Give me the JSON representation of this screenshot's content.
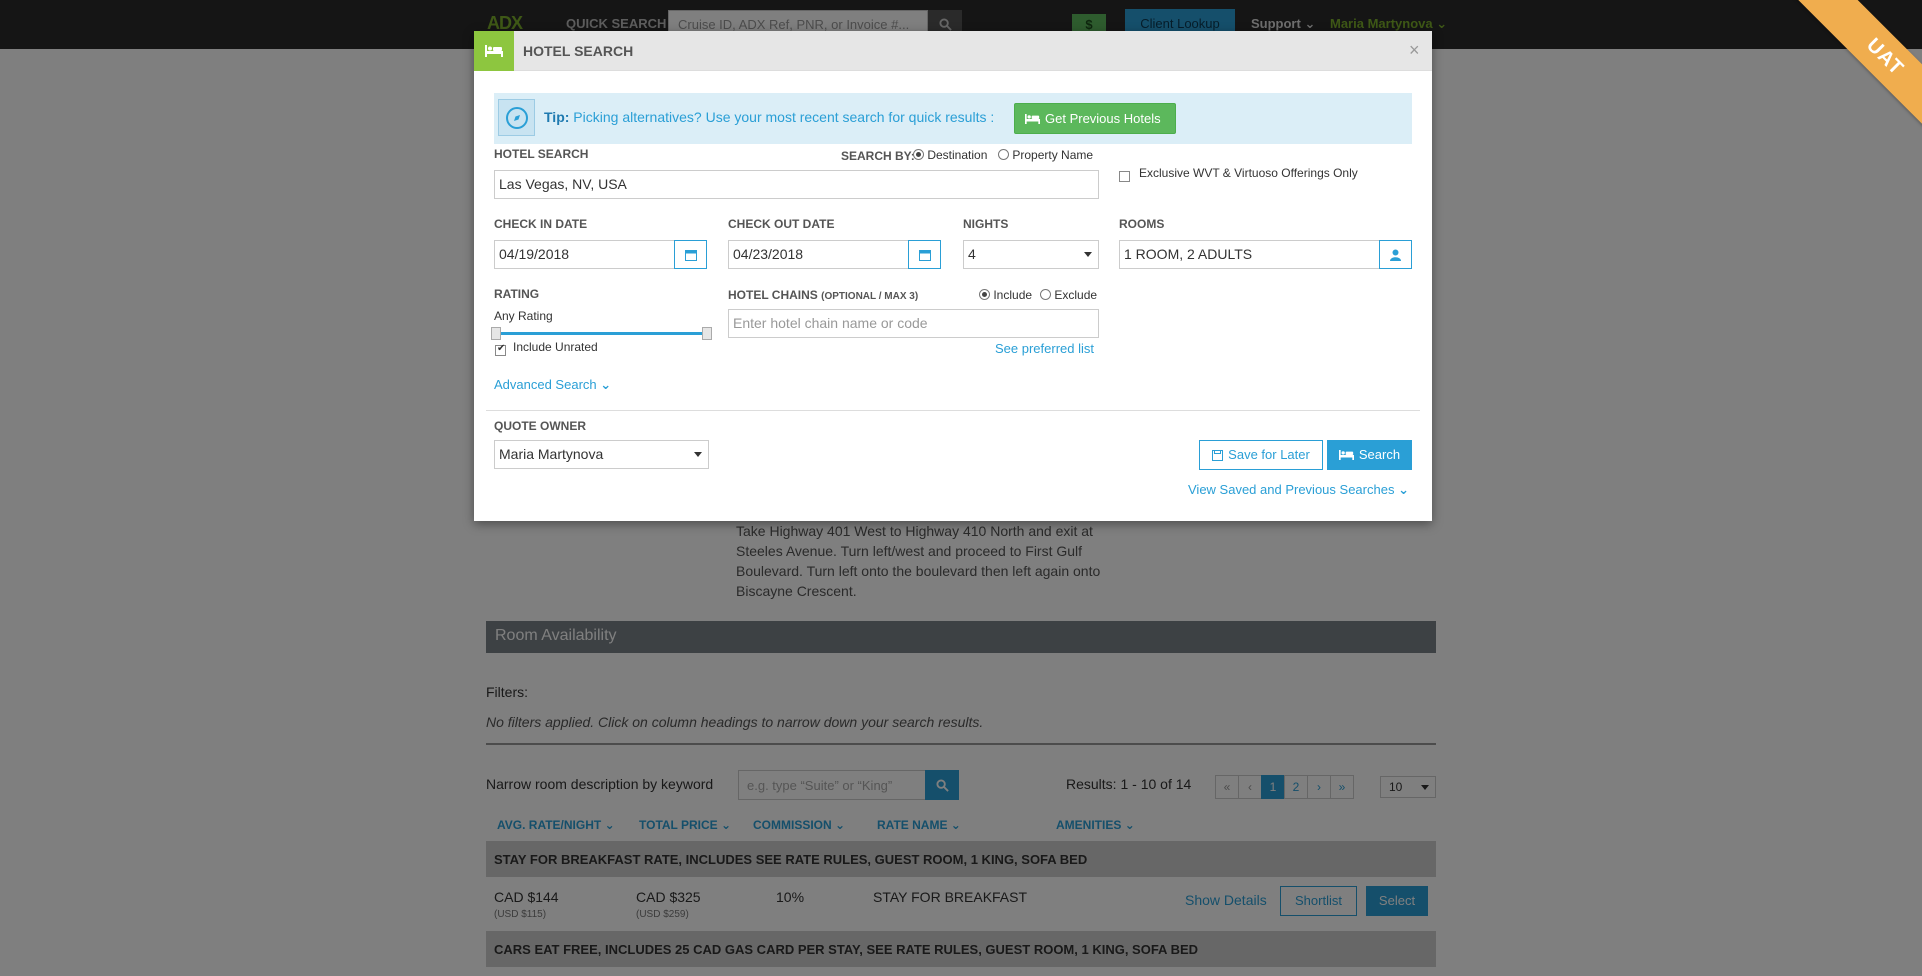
{
  "topnav": {
    "logo": "ADX",
    "quick_search_label": "QUICK SEARCH",
    "quick_search_placeholder": "Cruise ID, ADX Ref, PNR, or Invoice #...",
    "dollar_label": "$",
    "client_lookup_label": "Client Lookup",
    "support_label": "Support",
    "user_label": "Maria Martynova"
  },
  "env_badge": "UAT",
  "background": {
    "directions": "Take Highway 401 West to Highway 410 North and exit at Steeles Avenue. Turn left/west and proceed to First Gulf Boulevard. Turn left onto the boulevard then left again onto Biscayne Crescent.",
    "room_availability_title": "Room Availability",
    "filters_label": "Filters:",
    "no_filters_text": "No filters applied. Click on column headings to narrow down your search results.",
    "narrow_label": "Narrow room description by keyword",
    "keyword_placeholder": "e.g. type “Suite” or “King”",
    "results_text": "Results: 1 - 10 of 14",
    "pager": [
      "«",
      "‹",
      "1",
      "2",
      "›",
      "»"
    ],
    "per_page": "10",
    "columns": [
      "AVG. RATE/NIGHT",
      "TOTAL PRICE",
      "COMMISSION",
      "RATE NAME",
      "AMENITIES"
    ],
    "rates": [
      {
        "title": "STAY FOR BREAKFAST RATE, INCLUDES SEE RATE RULES, GUEST ROOM, 1 KING, SOFA BED",
        "avg_rate": "CAD $144",
        "avg_rate_usd": "(USD $115)",
        "total": "CAD $325",
        "total_usd": "(USD $259)",
        "commission": "10%",
        "rate_name": "STAY FOR BREAKFAST",
        "show_details": "Show Details",
        "shortlist": "Shortlist",
        "select": "Select"
      },
      {
        "title": "CARS EAT FREE, INCLUDES 25 CAD GAS CARD PER STAY, SEE RATE RULES, GUEST ROOM, 1 KING, SOFA BED"
      }
    ]
  },
  "modal": {
    "title": "HOTEL SEARCH",
    "tip_label": "Tip:",
    "tip_text": "Picking alternatives? Use your most recent search for quick results :",
    "get_previous_label": "Get Previous Hotels",
    "hotel_search_label": "HOTEL SEARCH",
    "search_by_label": "SEARCH BY:",
    "search_by_options": [
      "Destination",
      "Property Name"
    ],
    "destination_value": "Las Vegas, NV, USA",
    "exclusive_label": "Exclusive WVT & Virtuoso Offerings Only",
    "check_in_label": "CHECK IN DATE",
    "check_in_value": "04/19/2018",
    "check_out_label": "CHECK OUT DATE",
    "check_out_value": "04/23/2018",
    "nights_label": "NIGHTS",
    "nights_value": "4",
    "rooms_label": "ROOMS",
    "rooms_value": "1 ROOM, 2 ADULTS",
    "rating_label": "RATING",
    "rating_value": "Any Rating",
    "include_unrated_label": "Include Unrated",
    "hotel_chains_label": "HOTEL CHAINS",
    "hotel_chains_hint": "(OPTIONAL / MAX 3)",
    "chain_include_label": "Include",
    "chain_exclude_label": "Exclude",
    "chain_placeholder": "Enter hotel chain name or code",
    "preferred_list_link": "See preferred list",
    "advanced_search_link": "Advanced Search",
    "quote_owner_label": "QUOTE OWNER",
    "quote_owner_value": "Maria Martynova",
    "save_later_label": "Save for Later",
    "search_label": "Search",
    "view_saved_link": "View Saved and Previous Searches"
  },
  "colors": {
    "accent_blue": "#2a9fd6",
    "success_green": "#5cb85c",
    "uat_orange": "#f0ad4e",
    "logo_green": "#8dc63f"
  }
}
